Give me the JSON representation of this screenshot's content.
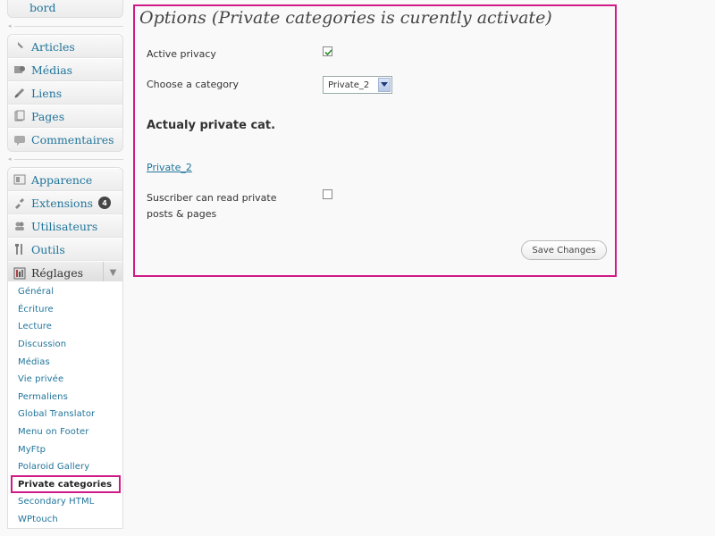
{
  "sidebar": {
    "top_item": "bord",
    "group1": [
      {
        "label": "Articles",
        "icon": "pushpin-icon"
      },
      {
        "label": "Médias",
        "icon": "media-icon"
      },
      {
        "label": "Liens",
        "icon": "link-icon"
      },
      {
        "label": "Pages",
        "icon": "pages-icon"
      },
      {
        "label": "Commentaires",
        "icon": "comment-icon"
      }
    ],
    "group2": [
      {
        "label": "Apparence",
        "icon": "appearance-icon"
      },
      {
        "label": "Extensions",
        "icon": "plugin-icon",
        "badge": "4"
      },
      {
        "label": "Utilisateurs",
        "icon": "users-icon"
      },
      {
        "label": "Outils",
        "icon": "tools-icon"
      }
    ],
    "settings": {
      "label": "Réglages",
      "icon": "settings-icon"
    },
    "submenu": [
      "Général",
      "Écriture",
      "Lecture",
      "Discussion",
      "Médias",
      "Vie privée",
      "Permaliens",
      "Global Translator",
      "Menu on Footer",
      "MyFtp",
      "Polaroid Gallery",
      "Private categories",
      "Secondary HTML",
      "WPtouch"
    ],
    "active_submenu_index": 11
  },
  "options": {
    "title": "Options (Private categories is curently activate)",
    "active_privacy_label": "Active privacy",
    "active_privacy_checked": true,
    "choose_category_label": "Choose a category",
    "category_value": "Private_2",
    "private_heading": "Actualy private cat.",
    "private_link": "Private_2",
    "subscriber_label_line1": "Suscriber can read private",
    "subscriber_label_line2": "posts & pages",
    "subscriber_checked": false,
    "save_button": "Save Changes"
  },
  "colors": {
    "highlight": "#cf1b87",
    "link": "#21759b"
  }
}
